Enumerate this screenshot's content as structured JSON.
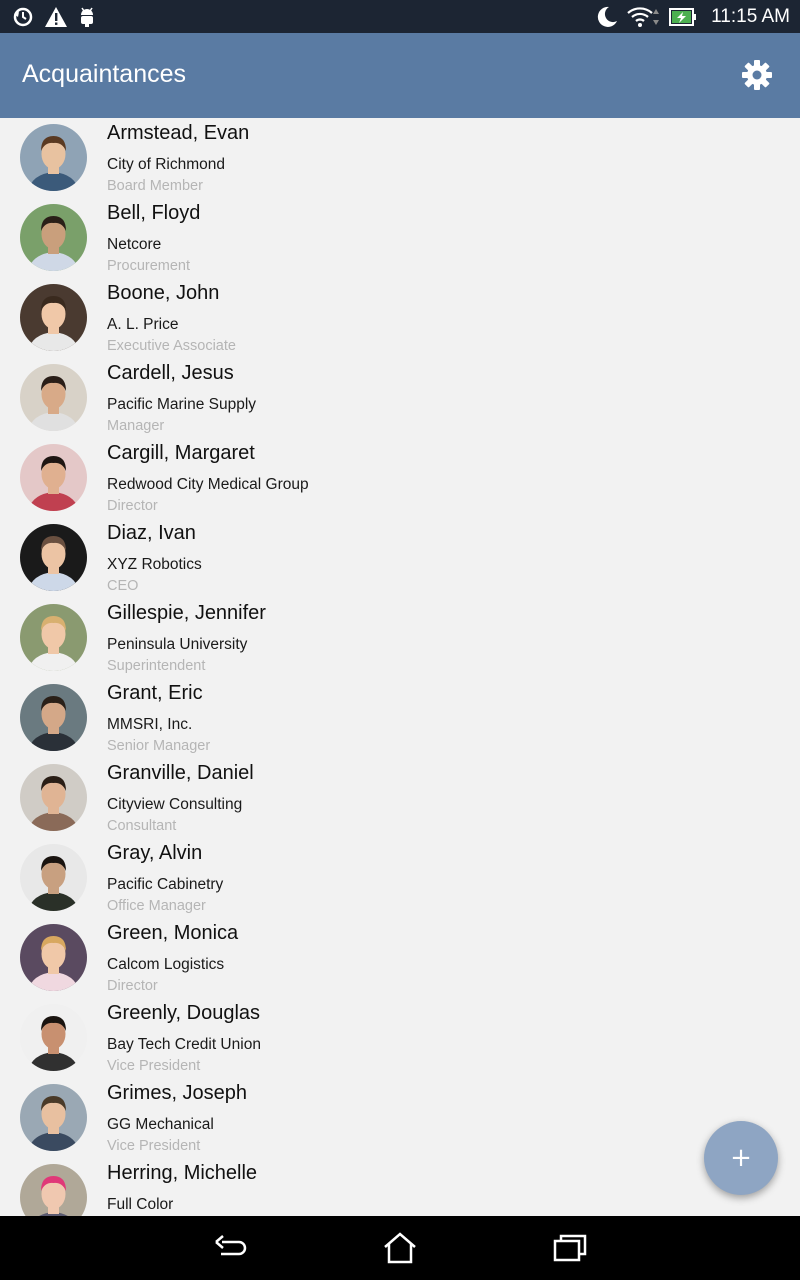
{
  "status_bar": {
    "time": "11:15 AM",
    "icons_left": [
      "sync-icon",
      "warning-icon",
      "android-debug-icon"
    ],
    "icons_right": [
      "night-mode-icon",
      "wifi-icon",
      "battery-charging-icon"
    ]
  },
  "app_bar": {
    "title": "Acquaintances",
    "settings_icon": "gear-icon",
    "color": "#5a7ba3"
  },
  "contacts": [
    {
      "name": "Armstead, Evan",
      "company": "City of Richmond",
      "title": "Board Member",
      "avatar_bg": "#8fa3b5",
      "skin": "#e8c2a0",
      "hair": "#5a3a22",
      "shirt": "#3b5a7a"
    },
    {
      "name": "Bell, Floyd",
      "company": "Netcore",
      "title": "Procurement",
      "avatar_bg": "#7aa06a",
      "skin": "#c99f7c",
      "hair": "#2a1f18",
      "shirt": "#cfd8e6"
    },
    {
      "name": "Boone, John",
      "company": "A. L. Price",
      "title": "Executive Associate",
      "avatar_bg": "#4a3a30",
      "skin": "#f0c8a8",
      "hair": "#3a2a1e",
      "shirt": "#e8e8e8"
    },
    {
      "name": "Cardell, Jesus",
      "company": "Pacific Marine Supply",
      "title": "Manager",
      "avatar_bg": "#d8d2c8",
      "skin": "#d8aa88",
      "hair": "#2a1e18",
      "shirt": "#e0e0e0"
    },
    {
      "name": "Cargill, Margaret",
      "company": "Redwood City Medical Group",
      "title": "Director",
      "avatar_bg": "#e4c8c8",
      "skin": "#e0b090",
      "hair": "#1e1612",
      "shirt": "#c04050"
    },
    {
      "name": "Diaz, Ivan",
      "company": "XYZ Robotics",
      "title": "CEO",
      "avatar_bg": "#1a1a1a",
      "skin": "#ecc4a4",
      "hair": "#6a5040",
      "shirt": "#cdd8e8"
    },
    {
      "name": "Gillespie, Jennifer",
      "company": "Peninsula University",
      "title": "Superintendent",
      "avatar_bg": "#8a9a70",
      "skin": "#f0c8a8",
      "hair": "#d8b070",
      "shirt": "#f0f0f0"
    },
    {
      "name": "Grant, Eric",
      "company": "MMSRI, Inc.",
      "title": "Senior Manager",
      "avatar_bg": "#6a7a80",
      "skin": "#d4a888",
      "hair": "#2a2018",
      "shirt": "#2a3038"
    },
    {
      "name": "Granville, Daniel",
      "company": "Cityview Consulting",
      "title": "Consultant",
      "avatar_bg": "#d0ccc6",
      "skin": "#e0b494",
      "hair": "#2a1e16",
      "shirt": "#8a6a58"
    },
    {
      "name": "Gray, Alvin",
      "company": "Pacific Cabinetry",
      "title": "Office Manager",
      "avatar_bg": "#e8e8e8",
      "skin": "#c8a080",
      "hair": "#1a1410",
      "shirt": "#2a3028"
    },
    {
      "name": "Green, Monica",
      "company": "Calcom Logistics",
      "title": "Director",
      "avatar_bg": "#5a4a60",
      "skin": "#f0c8a8",
      "hair": "#d8a860",
      "shirt": "#f0d8e0"
    },
    {
      "name": "Greenly, Douglas",
      "company": "Bay Tech Credit Union",
      "title": "Vice President",
      "avatar_bg": "#f0f0f0",
      "skin": "#c89070",
      "hair": "#1a1410",
      "shirt": "#303030"
    },
    {
      "name": "Grimes, Joseph",
      "company": "GG Mechanical",
      "title": "Vice President",
      "avatar_bg": "#9aa8b4",
      "skin": "#e8c0a0",
      "hair": "#4a3a28",
      "shirt": "#3a4a60"
    },
    {
      "name": "Herring, Michelle",
      "company": "Full Color",
      "title": "",
      "avatar_bg": "#b0a898",
      "skin": "#f0c8b0",
      "hair": "#e03878",
      "shirt": "#5a5a70"
    }
  ],
  "fab": {
    "label": "+",
    "color": "#8ea5c3"
  },
  "nav_bar": {
    "back_icon": "back-icon",
    "home_icon": "home-icon",
    "recents_icon": "recent-apps-icon"
  }
}
